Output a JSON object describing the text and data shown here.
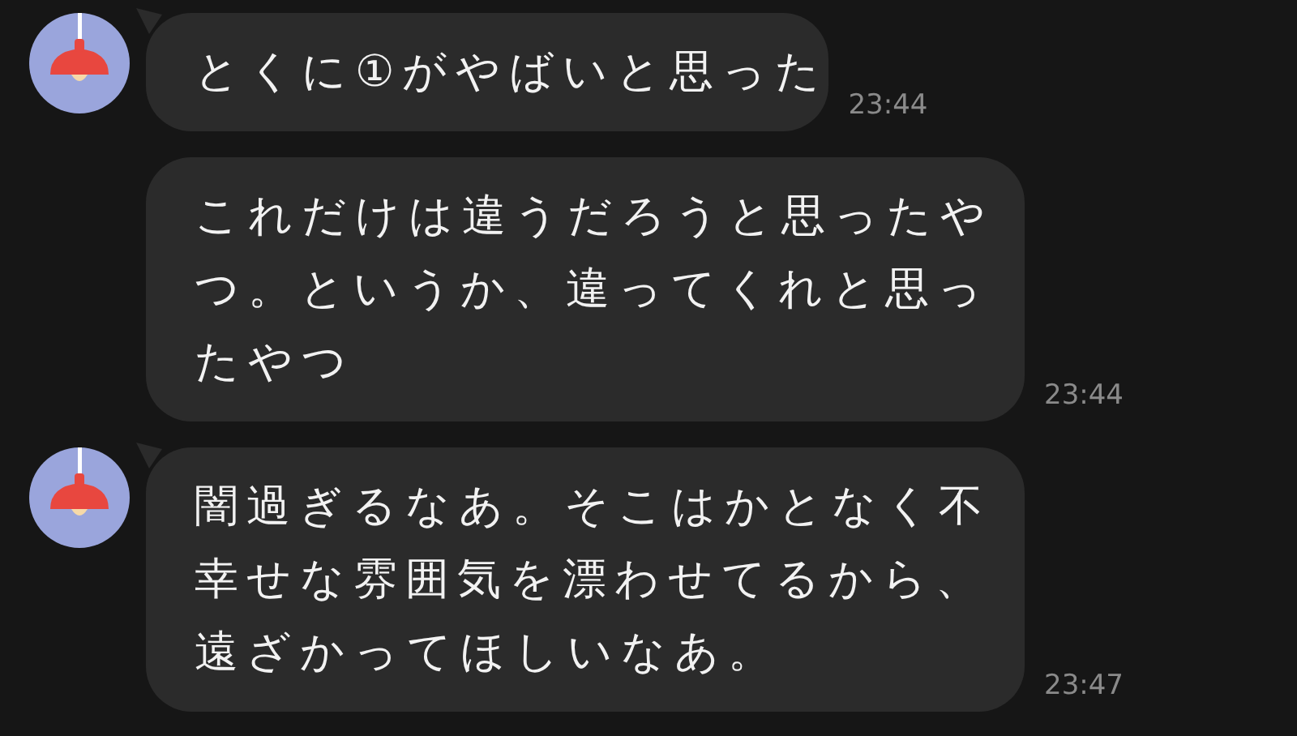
{
  "messages": [
    {
      "avatar": true,
      "text": "とくに①がやばいと思った",
      "time": "23:44"
    },
    {
      "avatar": false,
      "text": "これだけは違うだろうと思ったやつ。というか、違ってくれと思ったやつ",
      "time": "23:44"
    },
    {
      "avatar": true,
      "text": "闇過ぎるなあ。そこはかとなく不幸せな雰囲気を漂わせてるから、遠ざかってほしいなあ。",
      "time": "23:47"
    }
  ]
}
